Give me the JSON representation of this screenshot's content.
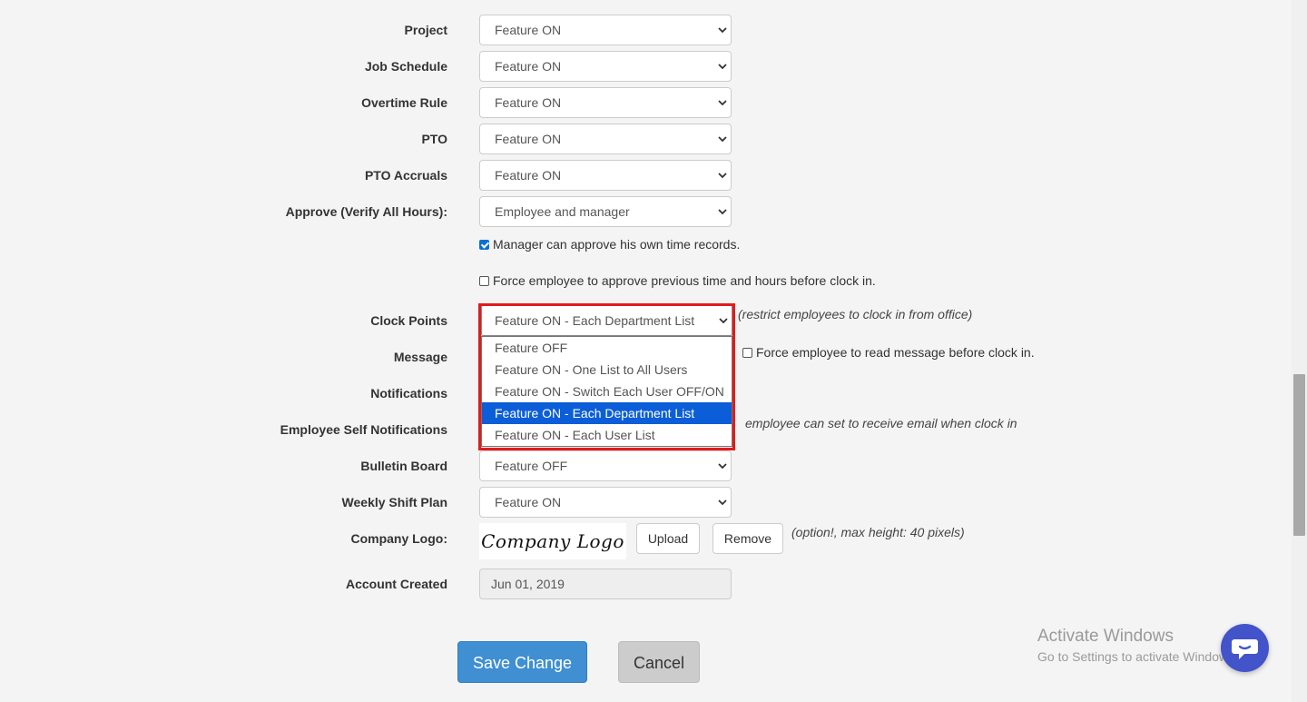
{
  "settings": {
    "project": {
      "label": "Project",
      "value": "Feature ON"
    },
    "job_schedule": {
      "label": "Job Schedule",
      "value": "Feature ON"
    },
    "overtime_rule": {
      "label": "Overtime Rule",
      "value": "Feature ON"
    },
    "pto": {
      "label": "PTO",
      "value": "Feature ON"
    },
    "pto_accruals": {
      "label": "PTO Accruals",
      "value": "Feature ON"
    },
    "approve": {
      "label": "Approve (Verify All Hours):",
      "value": "Employee and manager"
    },
    "manager_approve_own": {
      "label": "Manager can approve his own time records.",
      "checked": true
    },
    "force_employee_approve": {
      "label": "Force employee to approve previous time and hours before clock in.",
      "checked": false
    },
    "clock_points": {
      "label": "Clock Points",
      "value": "Feature ON - Each Department List",
      "hint": "(restrict employees to clock in from office)",
      "options": [
        "Feature OFF",
        "Feature ON - One List to All Users",
        "Feature ON - Switch Each User OFF/ON",
        "Feature ON - Each Department List",
        "Feature ON - Each User List"
      ],
      "highlighted_index": 3
    },
    "message": {
      "label": "Message",
      "force_read_label": "Force employee to read message before clock in.",
      "force_read_checked": false
    },
    "notifications": {
      "label": "Notifications"
    },
    "employee_self_notifications": {
      "label": "Employee Self Notifications",
      "hint": "employee can set to receive email when clock in"
    },
    "bulletin_board": {
      "label": "Bulletin Board",
      "value": "Feature OFF"
    },
    "weekly_shift_plan": {
      "label": "Weekly Shift Plan",
      "value": "Feature ON"
    },
    "company_logo": {
      "label": "Company Logo:",
      "logo_text": "Company Logo",
      "upload_label": "Upload",
      "remove_label": "Remove",
      "hint": "(option!, max height: 40 pixels)"
    },
    "account_created": {
      "label": "Account Created",
      "value": "Jun 01, 2019"
    }
  },
  "actions": {
    "save_label": "Save Change",
    "cancel_label": "Cancel"
  },
  "watermark": {
    "title": "Activate Windows",
    "subtitle": "Go to Settings to activate Windows."
  },
  "icons": {
    "chevron": "chevron-down-icon",
    "chat": "chat-icon"
  },
  "colors": {
    "highlight_border": "#e21b1b",
    "selected_option": "#0b5ed7",
    "save_button": "#3f8fd2",
    "chat_bubble": "#4353c9"
  }
}
